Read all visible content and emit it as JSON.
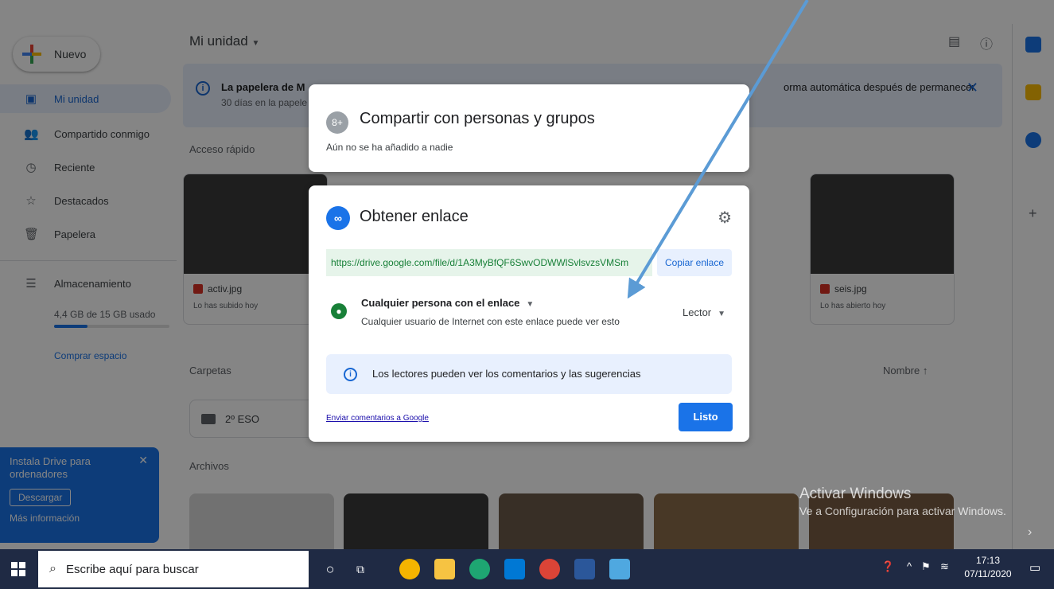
{
  "sidebar": {
    "new_label": "Nuevo",
    "items": [
      {
        "label": "Mi unidad",
        "icon": "drive-icon"
      },
      {
        "label": "Compartido conmigo",
        "icon": "people-icon"
      },
      {
        "label": "Reciente",
        "icon": "clock-icon"
      },
      {
        "label": "Destacados",
        "icon": "star-icon"
      },
      {
        "label": "Papelera",
        "icon": "trash-icon"
      },
      {
        "label": "Almacenamiento",
        "icon": "storage-icon"
      }
    ],
    "storage_text": "4,4 GB de 15 GB usado",
    "storage_used_fraction": 0.29,
    "buy_space": "Comprar espacio",
    "install": {
      "title": "Instala Drive para ordenadores",
      "download": "Descargar",
      "more": "Más información"
    }
  },
  "main": {
    "title": "Mi unidad",
    "banner": {
      "line1": "La papelera de M",
      "line2": "30 días en la papele",
      "line3": "orma automática después de permanecer"
    },
    "quick_access": "Acceso rápido",
    "cards": [
      {
        "name": "activ.jpg",
        "sub": "Lo has subido hoy"
      },
      {
        "name": "seis.jpg",
        "sub": "Lo has abierto hoy"
      }
    ],
    "folders_label": "Carpetas",
    "sort_label": "Nombre",
    "folder": "2º ESO",
    "files_label": "Archivos"
  },
  "share_dialog": {
    "title": "Compartir con personas y grupos",
    "subtitle": "Aún no se ha añadido a nadie"
  },
  "link_dialog": {
    "title": "Obtener enlace",
    "url": "https://drive.google.com/file/d/1A3MyBfQF6SwvODWWlSvlsvzsVMSm",
    "copy_label": "Copiar enlace",
    "access_title": "Cualquier persona con el enlace",
    "access_sub": "Cualquier usuario de Internet con este enlace puede ver esto",
    "role": "Lector",
    "info": "Los lectores pueden ver los comentarios y las sugerencias",
    "feedback": "Enviar comentarios a Google",
    "done": "Listo"
  },
  "watermark": {
    "line1": "Activar Windows",
    "line2": "Ve a Configuración para activar Windows."
  },
  "taskbar": {
    "search_placeholder": "Escribe aquí para buscar",
    "time": "17:13",
    "date": "07/11/2020"
  },
  "colors": {
    "accent": "#1a73e8",
    "arrow": "#5b9bd5",
    "taskbar": "#1f2a44"
  }
}
